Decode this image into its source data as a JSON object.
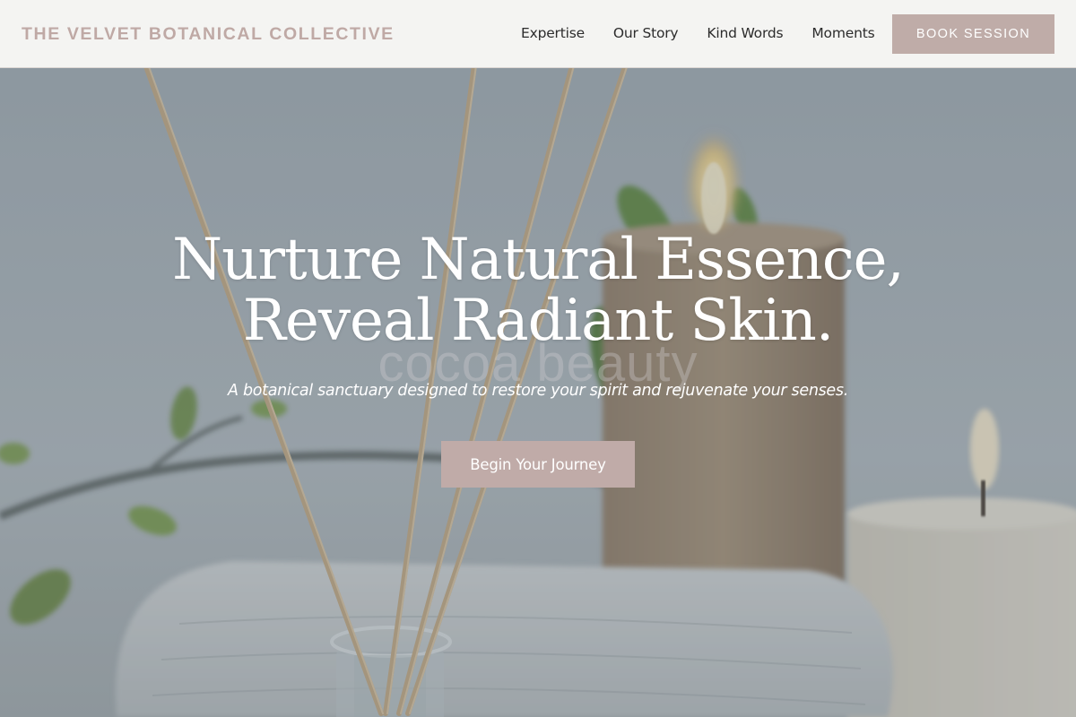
{
  "header": {
    "brand": "THE VELVET BOTANICAL COLLECTIVE",
    "nav": [
      {
        "label": "Expertise"
      },
      {
        "label": "Our Story"
      },
      {
        "label": "Kind Words"
      },
      {
        "label": "Moments"
      }
    ],
    "book_button": "BOOK SESSION"
  },
  "hero": {
    "headline_line1": "Nurture Natural Essence,",
    "headline_line2": "Reveal Radiant Skin.",
    "watermark": "cocoa beauty",
    "subheadline": "A botanical sanctuary designed to restore your spirit and rejuvenate your senses.",
    "cta_button": "Begin Your Journey",
    "background_description_icon": "spa-photo"
  },
  "colors": {
    "brand": "#bfa9a5",
    "button": "#bfaca8",
    "header_bg": "#f8f7f5",
    "nav_text": "#2c2c2c"
  }
}
